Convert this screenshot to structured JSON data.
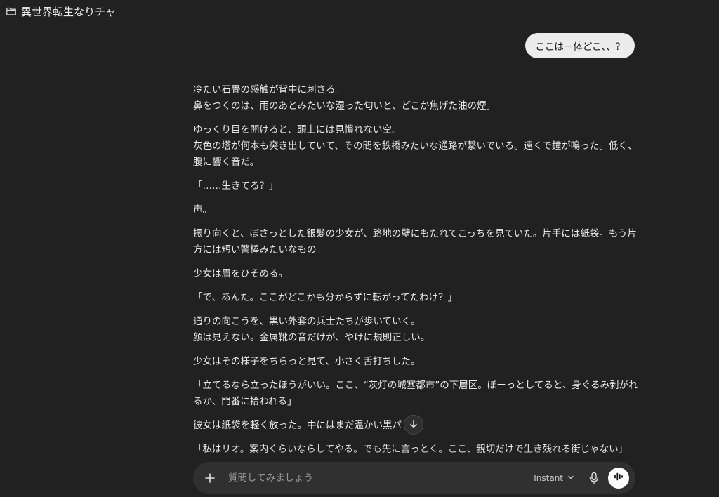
{
  "header": {
    "title": "異世界転生なりチャ"
  },
  "user_message": "ここは一体どこ、、？",
  "assistant_paragraphs": [
    "冷たい石畳の感触が背中に刺さる。\n鼻をつくのは、雨のあとみたいな湿った匂いと、どこか焦げた油の煙。",
    "ゆっくり目を開けると、頭上には見慣れない空。\n灰色の塔が何本も突き出していて、その間を鉄橋みたいな通路が繋いでいる。遠くで鐘が鳴った。低く、腹に響く音だ。",
    "「……生きてる？」",
    "声。",
    "振り向くと、ぼさっとした銀髪の少女が、路地の壁にもたれてこっちを見ていた。片手には紙袋。もう片方には短い警棒みたいなもの。",
    "少女は眉をひそめる。",
    "「で、あんた。ここがどこかも分からずに転がってたわけ？」",
    "通りの向こうを、黒い外套の兵士たちが歩いていく。\n顔は見えない。金属靴の音だけが、やけに規則正しい。",
    "少女はその様子をちらっと見て、小さく舌打ちした。",
    "「立てるなら立ったほうがいい。ここ、“灰灯の城塞都市”の下層区。ぼーっとしてると、身ぐるみ剥がれるか、門番に拾われる」",
    "彼女は紙袋を軽く放った。中にはまだ温かい黒パン",
    "「私はリオ。案内くらいならしてやる。でも先に言っとく。ここ、親切だけで生き残れる街じゃない」"
  ],
  "composer": {
    "placeholder": "質問してみましょう",
    "model_label": "Instant"
  },
  "icons": {
    "folder": "folder-icon",
    "plus": "plus-icon",
    "chevron": "chevron-down-icon",
    "mic": "microphone-icon",
    "voice": "voice-mode-icon",
    "scroll": "arrow-down-icon"
  }
}
